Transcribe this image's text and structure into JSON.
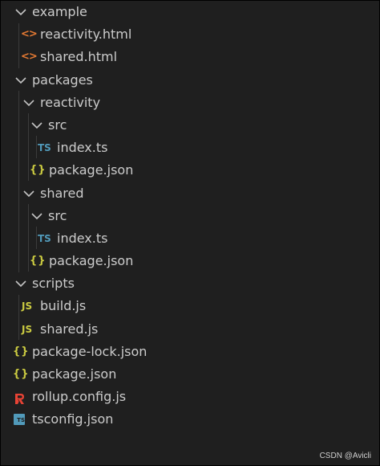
{
  "explorer": {
    "items": [
      {
        "label": "example",
        "kind": "folder",
        "icon": "chevron-down-icon"
      },
      {
        "label": "reactivity.html",
        "kind": "file",
        "icon": "html-file-icon",
        "glyph": "<>"
      },
      {
        "label": "shared.html",
        "kind": "file",
        "icon": "html-file-icon",
        "glyph": "<>"
      },
      {
        "label": "packages",
        "kind": "folder",
        "icon": "chevron-down-icon"
      },
      {
        "label": "reactivity",
        "kind": "folder",
        "icon": "chevron-down-icon"
      },
      {
        "label": "src",
        "kind": "folder",
        "icon": "chevron-down-icon"
      },
      {
        "label": "index.ts",
        "kind": "file",
        "icon": "typescript-file-icon",
        "glyph": "TS"
      },
      {
        "label": "package.json",
        "kind": "file",
        "icon": "json-file-icon",
        "glyph": "{}"
      },
      {
        "label": "shared",
        "kind": "folder",
        "icon": "chevron-down-icon"
      },
      {
        "label": "src",
        "kind": "folder",
        "icon": "chevron-down-icon"
      },
      {
        "label": "index.ts",
        "kind": "file",
        "icon": "typescript-file-icon",
        "glyph": "TS"
      },
      {
        "label": "package.json",
        "kind": "file",
        "icon": "json-file-icon",
        "glyph": "{}"
      },
      {
        "label": "scripts",
        "kind": "folder",
        "icon": "chevron-down-icon"
      },
      {
        "label": "build.js",
        "kind": "file",
        "icon": "javascript-file-icon",
        "glyph": "JS"
      },
      {
        "label": "shared.js",
        "kind": "file",
        "icon": "javascript-file-icon",
        "glyph": "JS"
      },
      {
        "label": "package-lock.json",
        "kind": "file",
        "icon": "json-file-icon",
        "glyph": "{}"
      },
      {
        "label": "package.json",
        "kind": "file",
        "icon": "json-file-icon",
        "glyph": "{}"
      },
      {
        "label": "rollup.config.js",
        "kind": "file",
        "icon": "rollup-file-icon",
        "glyph": "R"
      },
      {
        "label": "tsconfig.json",
        "kind": "file",
        "icon": "tsconfig-file-icon",
        "glyph": "TS"
      }
    ]
  },
  "watermark": "CSDN @Avicli",
  "colors": {
    "background": "#1f1f1f",
    "text": "#cccccc",
    "html_icon": "#e37933",
    "ts_icon": "#519aba",
    "json_icon": "#cbcb41",
    "js_icon": "#cbcb41",
    "rollup_icon": "#e84335"
  }
}
